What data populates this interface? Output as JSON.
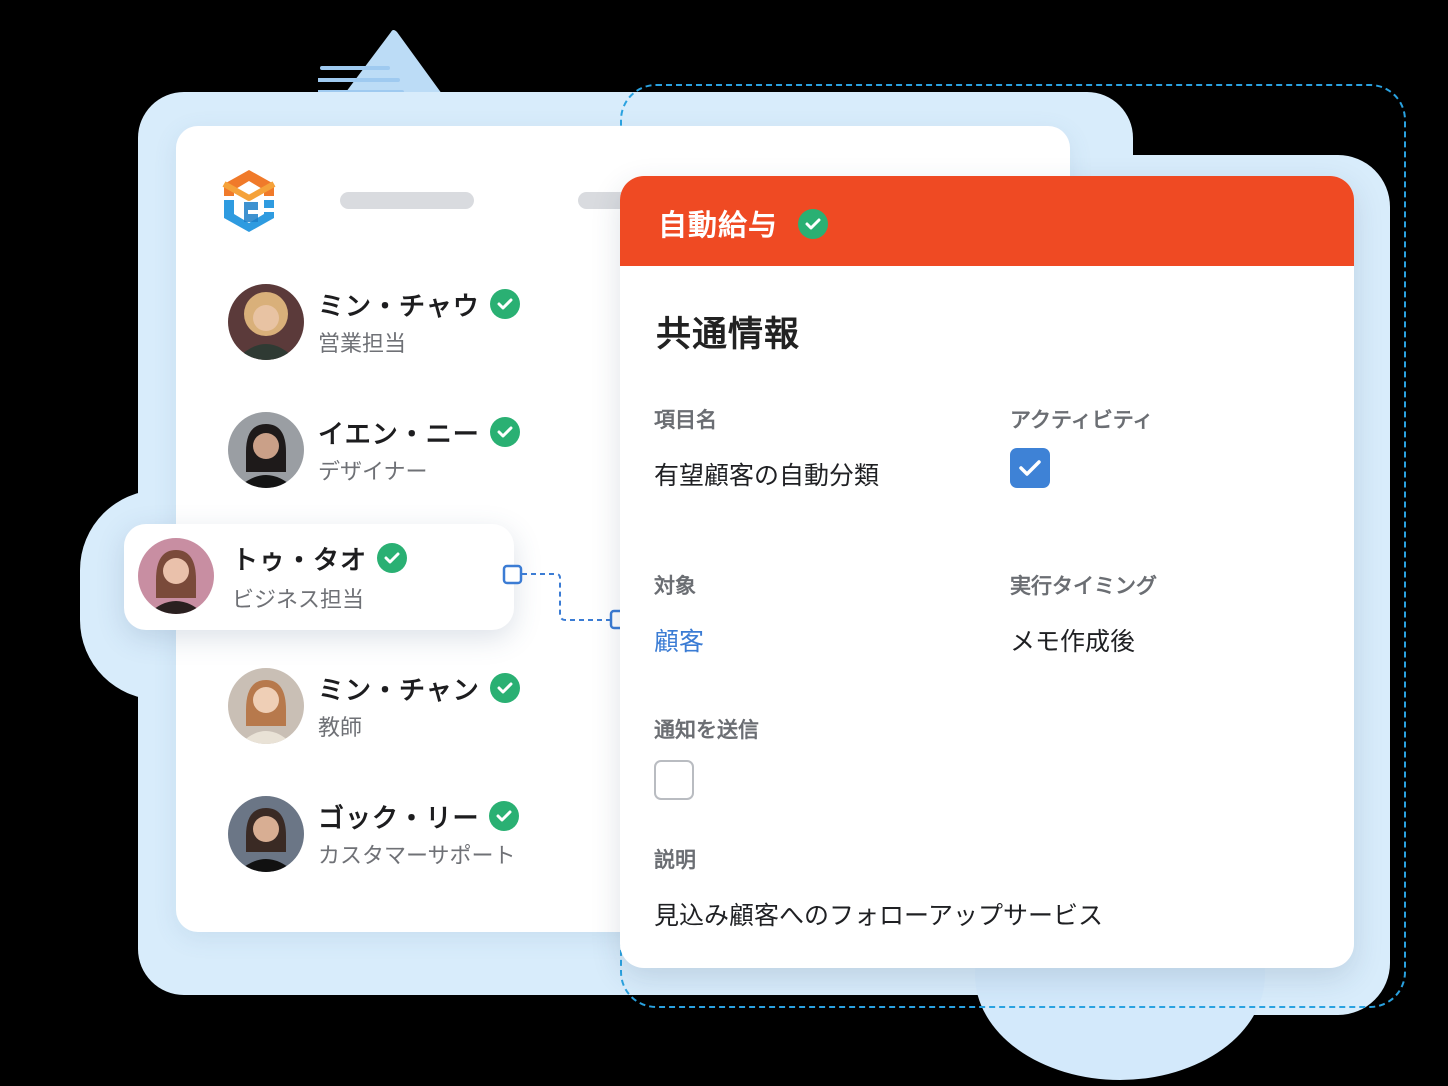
{
  "colors": {
    "accent_orange": "#ef4a23",
    "check_green": "#2ab073",
    "link_blue": "#3b7cd4",
    "checkbox_blue": "#3e82d6",
    "decor_blue": "#d8ecfb"
  },
  "contacts": [
    {
      "name": "ミン・チャウ",
      "role": "営業担当",
      "verified": true
    },
    {
      "name": "イエン・ニー",
      "role": "デザイナー",
      "verified": true
    },
    {
      "name": "トゥ・タオ",
      "role": "ビジネス担当",
      "verified": true,
      "selected": true
    },
    {
      "name": "ミン・チャン",
      "role": "教師",
      "verified": true
    },
    {
      "name": "ゴック・リー",
      "role": "カスタマーサポート",
      "verified": true
    }
  ],
  "detail": {
    "header_title": "自動給与",
    "header_verified": true,
    "section_title": "共通情報",
    "fields": {
      "item_name": {
        "label": "項目名",
        "value": "有望顧客の自動分類"
      },
      "activity": {
        "label": "アクティビティ",
        "checked": true
      },
      "target": {
        "label": "対象",
        "value": "顧客"
      },
      "timing": {
        "label": "実行タイミング",
        "value": "メモ作成後"
      },
      "notify": {
        "label": "通知を送信",
        "checked": false
      },
      "description": {
        "label": "説明",
        "value": "見込み顧客へのフォローアップサービス"
      }
    }
  }
}
